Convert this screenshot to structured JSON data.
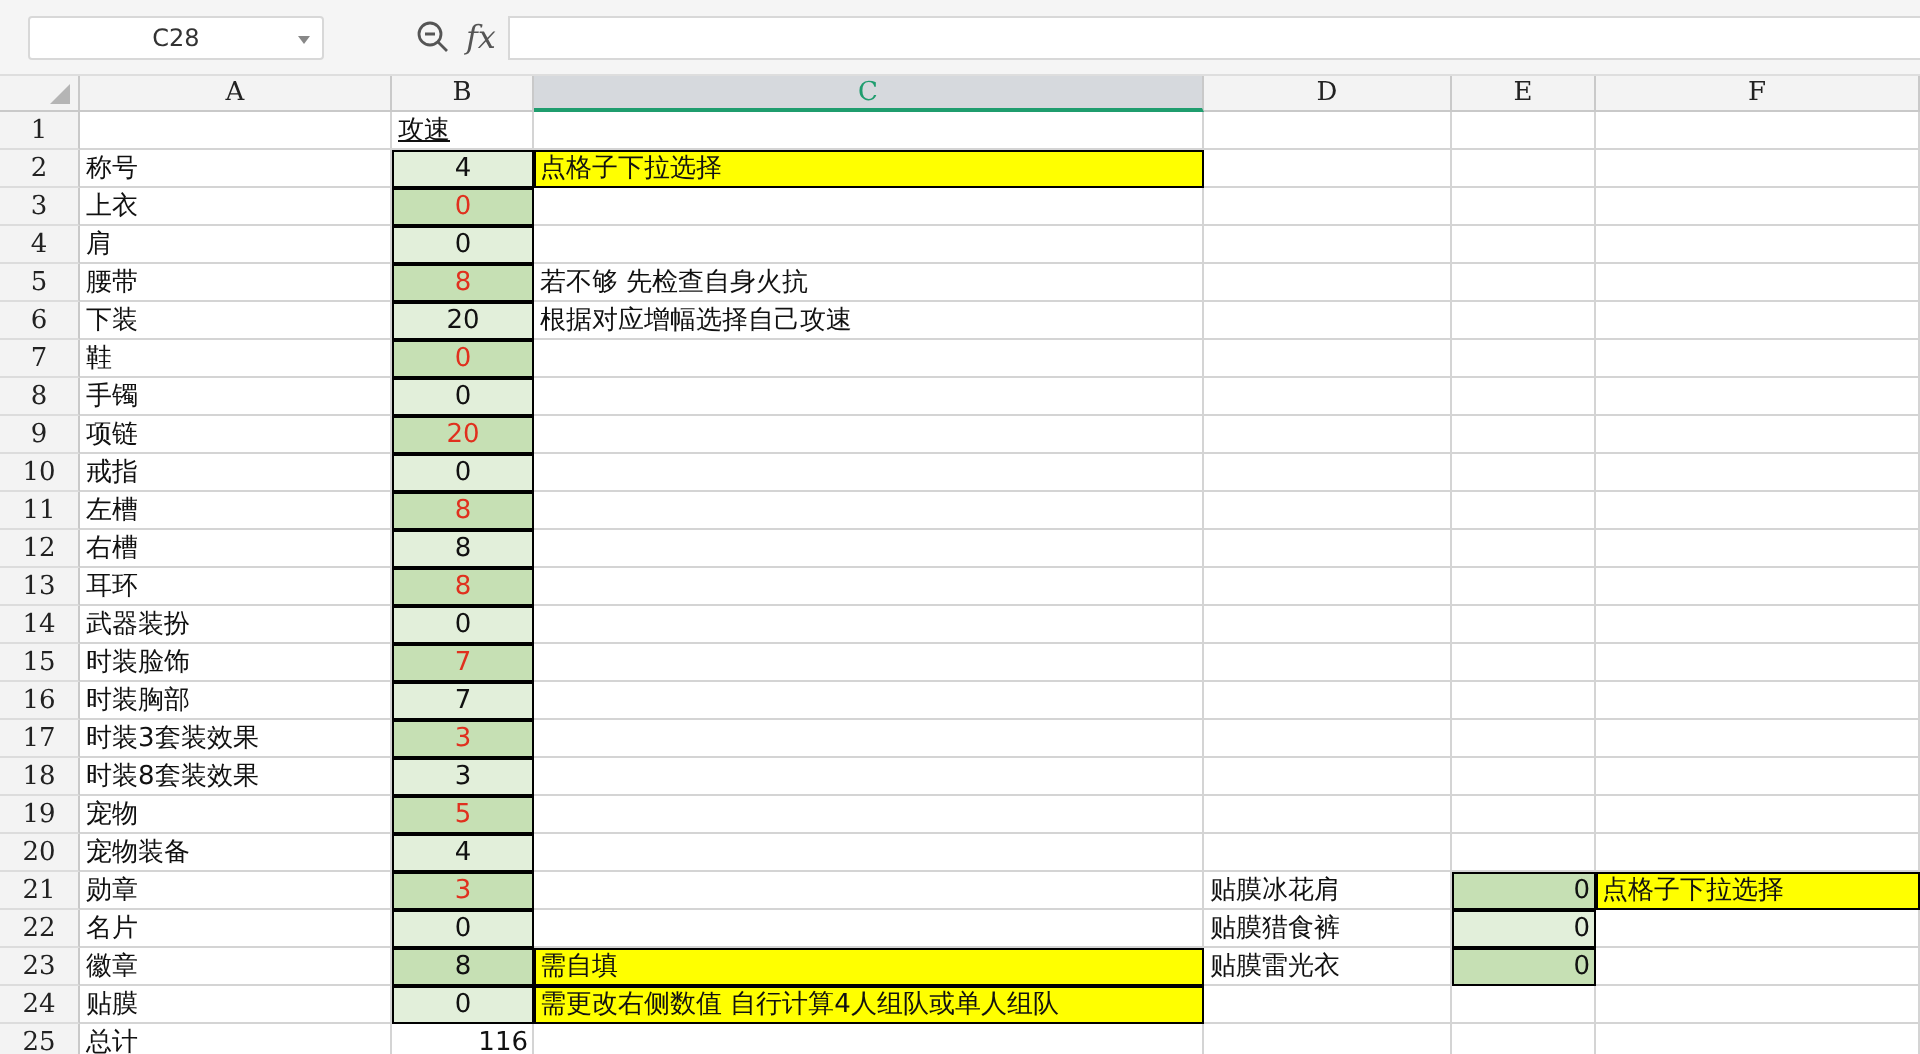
{
  "toolbar": {
    "name_box": "C28",
    "function_label": "fx"
  },
  "columns": [
    {
      "label": "A",
      "selected": false
    },
    {
      "label": "B",
      "selected": false
    },
    {
      "label": "C",
      "selected": true
    },
    {
      "label": "D",
      "selected": false
    },
    {
      "label": "E",
      "selected": false
    },
    {
      "label": "F",
      "selected": false
    }
  ],
  "rows": [
    {
      "number": "1",
      "cells": [
        {},
        {
          "text": "攻速",
          "underline": true
        },
        {},
        {},
        {},
        {}
      ]
    },
    {
      "number": "2",
      "cells": [
        {
          "text": "称号"
        },
        {
          "text": "4",
          "input": true,
          "dark": false,
          "alert": false
        },
        {
          "text": "点格子下拉选择",
          "highlighted": true
        },
        {},
        {},
        {}
      ]
    },
    {
      "number": "3",
      "cells": [
        {
          "text": "上衣"
        },
        {
          "text": "0",
          "input": true,
          "dark": true,
          "alert": true
        },
        {},
        {},
        {},
        {}
      ]
    },
    {
      "number": "4",
      "cells": [
        {
          "text": "肩"
        },
        {
          "text": "0",
          "input": true,
          "dark": false,
          "alert": false
        },
        {},
        {},
        {},
        {}
      ]
    },
    {
      "number": "5",
      "cells": [
        {
          "text": "腰带"
        },
        {
          "text": "8",
          "input": true,
          "dark": true,
          "alert": true
        },
        {
          "text": "若不够 先检查自身火抗"
        },
        {},
        {},
        {}
      ]
    },
    {
      "number": "6",
      "cells": [
        {
          "text": "下装"
        },
        {
          "text": "20",
          "input": true,
          "dark": false,
          "alert": false
        },
        {
          "text": "根据对应增幅选择自己攻速"
        },
        {},
        {},
        {}
      ]
    },
    {
      "number": "7",
      "cells": [
        {
          "text": "鞋"
        },
        {
          "text": "0",
          "input": true,
          "dark": true,
          "alert": true
        },
        {},
        {},
        {},
        {}
      ]
    },
    {
      "number": "8",
      "cells": [
        {
          "text": "手镯"
        },
        {
          "text": "0",
          "input": true,
          "dark": false,
          "alert": false
        },
        {},
        {},
        {},
        {}
      ]
    },
    {
      "number": "9",
      "cells": [
        {
          "text": "项链"
        },
        {
          "text": "20",
          "input": true,
          "dark": true,
          "alert": true
        },
        {},
        {},
        {},
        {}
      ]
    },
    {
      "number": "10",
      "cells": [
        {
          "text": "戒指"
        },
        {
          "text": "0",
          "input": true,
          "dark": false,
          "alert": false
        },
        {},
        {},
        {},
        {}
      ]
    },
    {
      "number": "11",
      "cells": [
        {
          "text": "左槽"
        },
        {
          "text": "8",
          "input": true,
          "dark": true,
          "alert": true
        },
        {},
        {},
        {},
        {}
      ]
    },
    {
      "number": "12",
      "cells": [
        {
          "text": "右槽"
        },
        {
          "text": "8",
          "input": true,
          "dark": false,
          "alert": false
        },
        {},
        {},
        {},
        {}
      ]
    },
    {
      "number": "13",
      "cells": [
        {
          "text": "耳环"
        },
        {
          "text": "8",
          "input": true,
          "dark": true,
          "alert": true
        },
        {},
        {},
        {},
        {}
      ]
    },
    {
      "number": "14",
      "cells": [
        {
          "text": "武器装扮"
        },
        {
          "text": "0",
          "input": true,
          "dark": false,
          "alert": false
        },
        {},
        {},
        {},
        {}
      ]
    },
    {
      "number": "15",
      "cells": [
        {
          "text": "时装脸饰"
        },
        {
          "text": "7",
          "input": true,
          "dark": true,
          "alert": true
        },
        {},
        {},
        {},
        {}
      ]
    },
    {
      "number": "16",
      "cells": [
        {
          "text": "时装胸部"
        },
        {
          "text": "7",
          "input": true,
          "dark": false,
          "alert": false
        },
        {},
        {},
        {},
        {}
      ]
    },
    {
      "number": "17",
      "cells": [
        {
          "text": "时装3套装效果"
        },
        {
          "text": "3",
          "input": true,
          "dark": true,
          "alert": true
        },
        {},
        {},
        {},
        {}
      ]
    },
    {
      "number": "18",
      "cells": [
        {
          "text": "时装8套装效果"
        },
        {
          "text": "3",
          "input": true,
          "dark": false,
          "alert": false
        },
        {},
        {},
        {},
        {}
      ]
    },
    {
      "number": "19",
      "cells": [
        {
          "text": "宠物"
        },
        {
          "text": "5",
          "input": true,
          "dark": true,
          "alert": true
        },
        {},
        {},
        {},
        {}
      ]
    },
    {
      "number": "20",
      "cells": [
        {
          "text": "宠物装备"
        },
        {
          "text": "4",
          "input": true,
          "dark": false,
          "alert": false
        },
        {},
        {},
        {},
        {}
      ]
    },
    {
      "number": "21",
      "cells": [
        {
          "text": "勋章"
        },
        {
          "text": "3",
          "input": true,
          "dark": true,
          "alert": true
        },
        {},
        {
          "text": "贴膜冰花肩"
        },
        {
          "text": "0",
          "input": true,
          "dark": true,
          "alert": false
        },
        {
          "text": "点格子下拉选择",
          "highlighted": true
        }
      ]
    },
    {
      "number": "22",
      "cells": [
        {
          "text": "名片"
        },
        {
          "text": "0",
          "input": true,
          "dark": false,
          "alert": false
        },
        {},
        {
          "text": "贴膜猎食裤"
        },
        {
          "text": "0",
          "input": true,
          "dark": false,
          "alert": false
        },
        {}
      ]
    },
    {
      "number": "23",
      "cells": [
        {
          "text": "徽章"
        },
        {
          "text": "8",
          "input": true,
          "dark": true,
          "alert": false
        },
        {
          "text": "需自填",
          "highlighted": true
        },
        {
          "text": "贴膜雷光衣"
        },
        {
          "text": "0",
          "input": true,
          "dark": true,
          "alert": false
        },
        {}
      ]
    },
    {
      "number": "24",
      "cells": [
        {
          "text": "贴膜"
        },
        {
          "text": "0",
          "input": true,
          "dark": false,
          "alert": false
        },
        {
          "text": "需更改右侧数值 自行计算4人组队或单人组队",
          "highlighted": true
        },
        {},
        {},
        {}
      ]
    },
    {
      "number": "25",
      "cells": [
        {
          "text": "总计"
        },
        {
          "text": "116"
        },
        {},
        {},
        {},
        {}
      ]
    }
  ]
}
